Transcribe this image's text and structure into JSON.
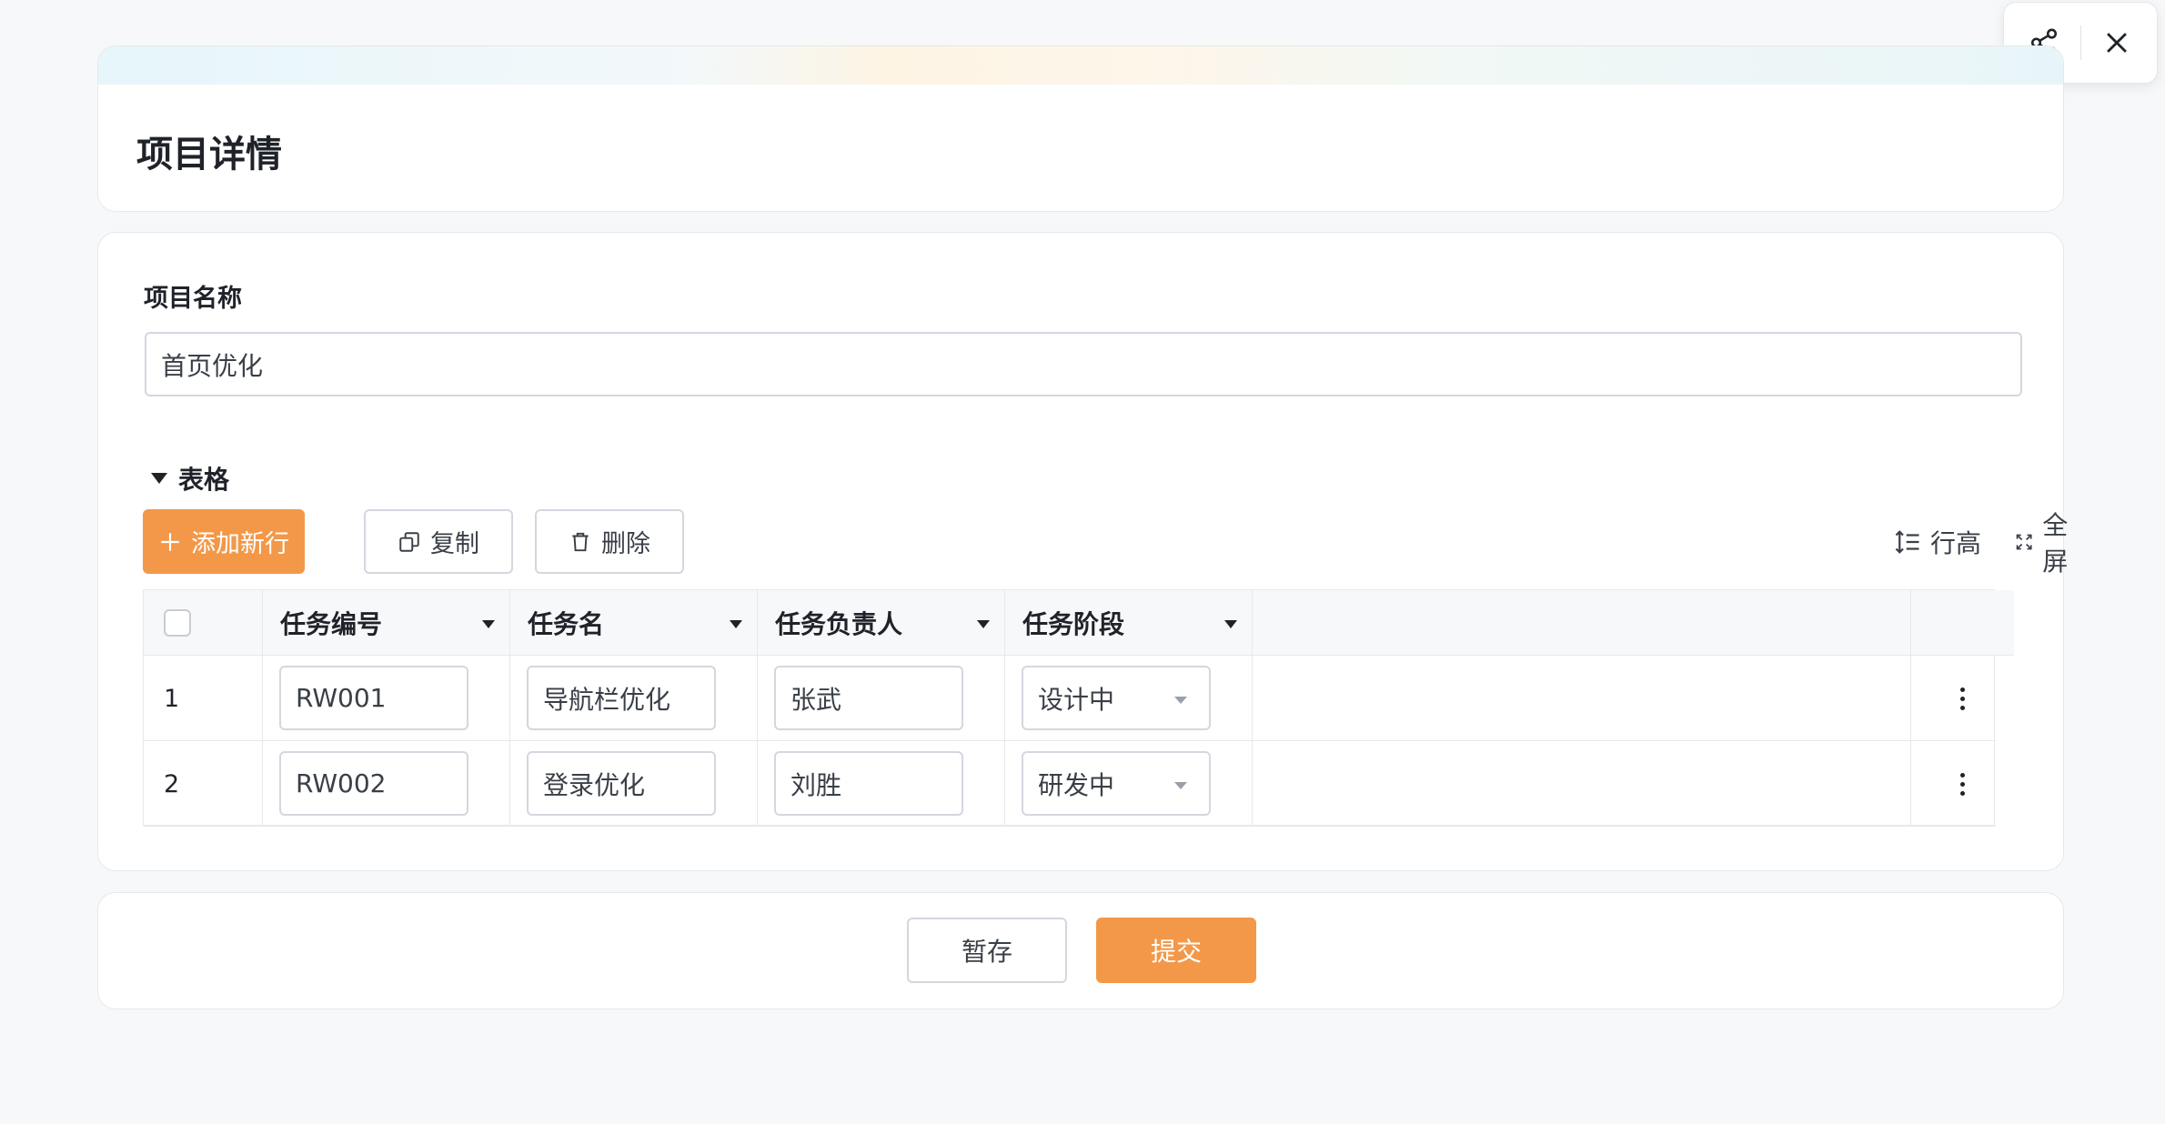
{
  "header": {
    "title": "项目详情"
  },
  "form": {
    "project_name_label": "项目名称",
    "project_name_value": "首页优化"
  },
  "table_section": {
    "title": "表格",
    "toolbar": {
      "add_row": "添加新行",
      "copy": "复制",
      "delete": "删除",
      "row_height": "行高",
      "fullscreen": "全屏"
    },
    "columns": [
      "任务编号",
      "任务名",
      "任务负责人",
      "任务阶段"
    ],
    "rows": [
      {
        "index": "1",
        "task_id": "RW001",
        "task_name": "导航栏优化",
        "owner": "张武",
        "stage": "设计中"
      },
      {
        "index": "2",
        "task_id": "RW002",
        "task_name": "登录优化",
        "owner": "刘胜",
        "stage": "研发中"
      }
    ]
  },
  "footer": {
    "save": "暂存",
    "submit": "提交"
  },
  "colors": {
    "accent": "#f39848",
    "border": "#d4d7de",
    "background": "#f7f8fa"
  },
  "icons": [
    "share-icon",
    "close-icon",
    "plus-icon",
    "copy-icon",
    "trash-icon",
    "row-height-icon",
    "fullscreen-icon",
    "more-vertical-icon"
  ]
}
